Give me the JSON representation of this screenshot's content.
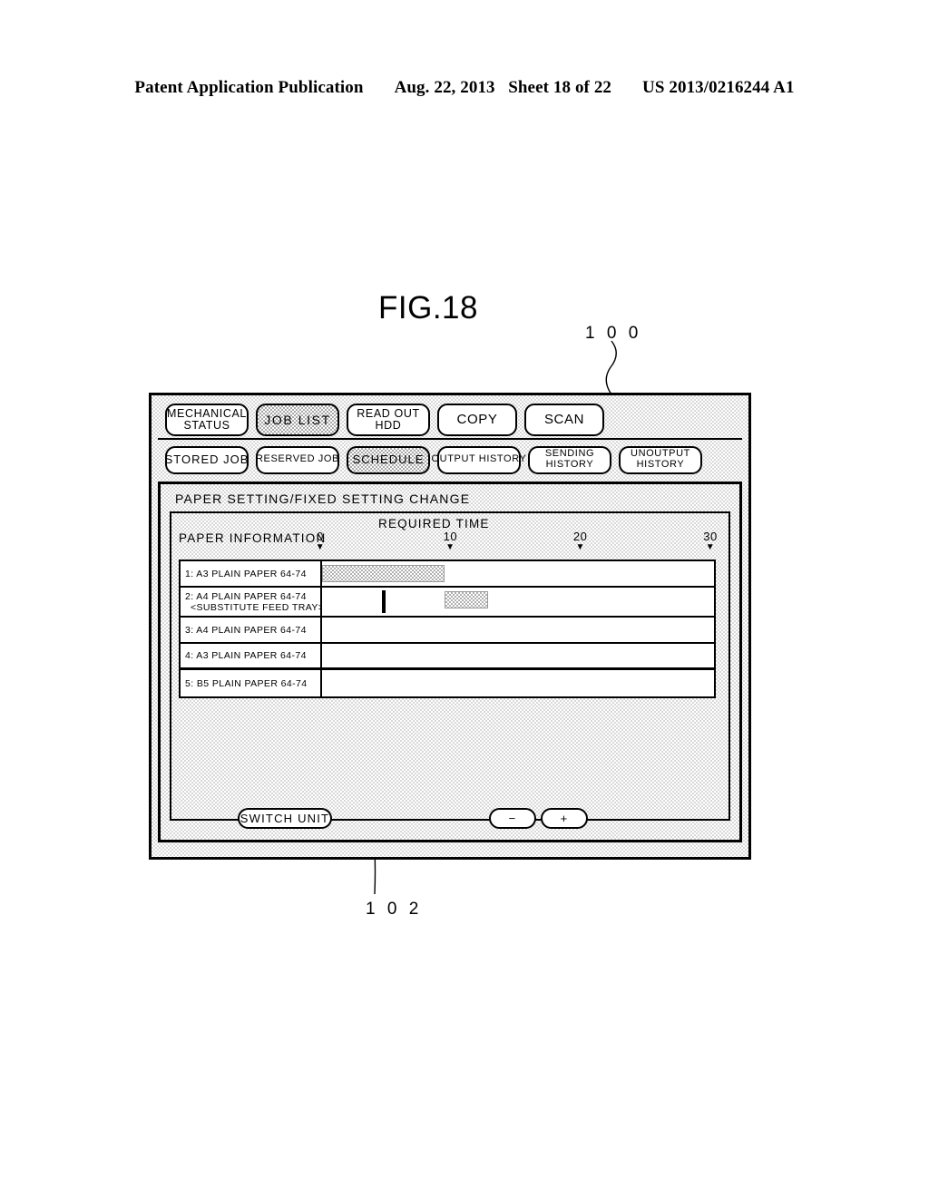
{
  "publication_header": {
    "left": "Patent Application Publication",
    "date": "Aug. 22, 2013",
    "sheet": "Sheet 18 of 22",
    "number": "US 2013/0216244 A1"
  },
  "figure": {
    "title": "FIG.18",
    "ref_device": "1 0 0",
    "ref_marker": "1 0 2"
  },
  "device": {
    "tab_row_1": [
      {
        "label_line1": "MECHANICAL",
        "label_line2": "STATUS",
        "selected": false
      },
      {
        "label_line1": "JOB LIST",
        "label_line2": "",
        "selected": true
      },
      {
        "label_line1": "READ OUT",
        "label_line2": "HDD",
        "selected": false
      },
      {
        "label_line1": "COPY",
        "label_line2": "",
        "selected": false
      },
      {
        "label_line1": "SCAN",
        "label_line2": "",
        "selected": false
      }
    ],
    "tab_row_2": [
      {
        "label_line1": "STORED JOB",
        "label_line2": "",
        "selected": false
      },
      {
        "label_line1": "RESERVED JOB",
        "label_line2": "",
        "selected": false
      },
      {
        "label_line1": "SCHEDULE",
        "label_line2": "",
        "selected": true
      },
      {
        "label_line1": "OUTPUT HISTORY",
        "label_line2": "",
        "selected": false
      },
      {
        "label_line1": "SENDING",
        "label_line2": "HISTORY",
        "selected": false
      },
      {
        "label_line1": "UNOUTPUT",
        "label_line2": "HISTORY",
        "selected": false
      }
    ],
    "panel_title": "PAPER SETTING/FIXED SETTING CHANGE",
    "schedule": {
      "paper_information_label": "PAPER INFORMATION",
      "required_time_label": "REQUIRED TIME"
    },
    "bottom": {
      "switch_unit": "SWITCH UNIT",
      "minus": "−",
      "plus": "+"
    }
  },
  "chart_data": {
    "type": "bar",
    "title": "REQUIRED TIME",
    "xlabel": "REQUIRED TIME",
    "ylabel": "PAPER INFORMATION",
    "xlim": [
      0,
      30
    ],
    "xticks": [
      0,
      10,
      20,
      30
    ],
    "xtick_labels": [
      "0",
      "10",
      "20",
      "30"
    ],
    "grid": false,
    "legend": "none",
    "orientation": "horizontal",
    "marker_value": 4.6,
    "categories": [
      "1: A3 PLAIN PAPER 64-74",
      "2: A4 PLAIN PAPER 64-74 <SUBSTITUTE FEED TRAY>",
      "3: A4 PLAIN PAPER 64-74",
      "4: A3 PLAIN PAPER 64-74",
      "5: B5 PLAIN PAPER 64-74"
    ],
    "rows": [
      {
        "index": "1",
        "label_line1": "1: A3 PLAIN PAPER 64-74",
        "label_line2": "",
        "bars": [
          {
            "start": 0.0,
            "end": 9.4
          }
        ],
        "marker": null
      },
      {
        "index": "2",
        "label_line1": "2: A4 PLAIN PAPER 64-74",
        "label_line2": "<SUBSTITUTE FEED TRAY>",
        "bars": [
          {
            "start": 9.4,
            "end": 12.8
          }
        ],
        "marker": 4.6
      },
      {
        "index": "3",
        "label_line1": "3: A4 PLAIN PAPER 64-74",
        "label_line2": "",
        "bars": [],
        "marker": null
      },
      {
        "index": "4",
        "label_line1": "4: A3 PLAIN PAPER 64-74",
        "label_line2": "",
        "bars": [],
        "marker": null
      },
      {
        "index": "5",
        "label_line1": "5: B5 PLAIN PAPER 64-74",
        "label_line2": "",
        "bars": [],
        "marker": null
      }
    ]
  }
}
